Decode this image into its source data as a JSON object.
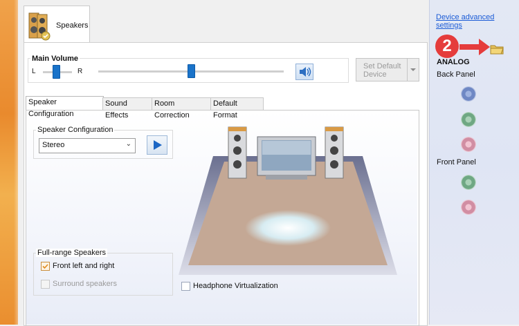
{
  "window": {
    "tab_label": "Speakers"
  },
  "main_volume": {
    "title": "Main Volume",
    "left_label": "L",
    "right_label": "R",
    "balance_position": 0.45,
    "level": 0.5
  },
  "set_default": {
    "label_line1": "Set Default",
    "label_line2": "Device",
    "enabled": false
  },
  "tabs": [
    {
      "label": "Speaker Configuration",
      "active": true
    },
    {
      "label": "Sound Effects",
      "active": false
    },
    {
      "label": "Room Correction",
      "active": false
    },
    {
      "label": "Default Format",
      "active": false
    }
  ],
  "speaker_config": {
    "group_title": "Speaker Configuration",
    "selected": "Stereo"
  },
  "full_range": {
    "group_title": "Full-range Speakers",
    "front_label": "Front left and right",
    "front_checked": true,
    "surround_label": "Surround speakers",
    "surround_enabled": false
  },
  "headphone": {
    "label": "Headphone Virtualization",
    "checked": false
  },
  "side_panel": {
    "link_line1": "Device advanced",
    "link_line2": "settings",
    "analog_label": "ANALOG",
    "back_panel_label": "Back Panel",
    "front_panel_label": "Front Panel",
    "badge_number": "2"
  },
  "colors": {
    "accent_blue": "#1a73c9",
    "badge_red": "#e53c3c",
    "jack_blue": "#7b95cf",
    "jack_green": "#7fae8f",
    "jack_pink": "#d9a3b3"
  }
}
